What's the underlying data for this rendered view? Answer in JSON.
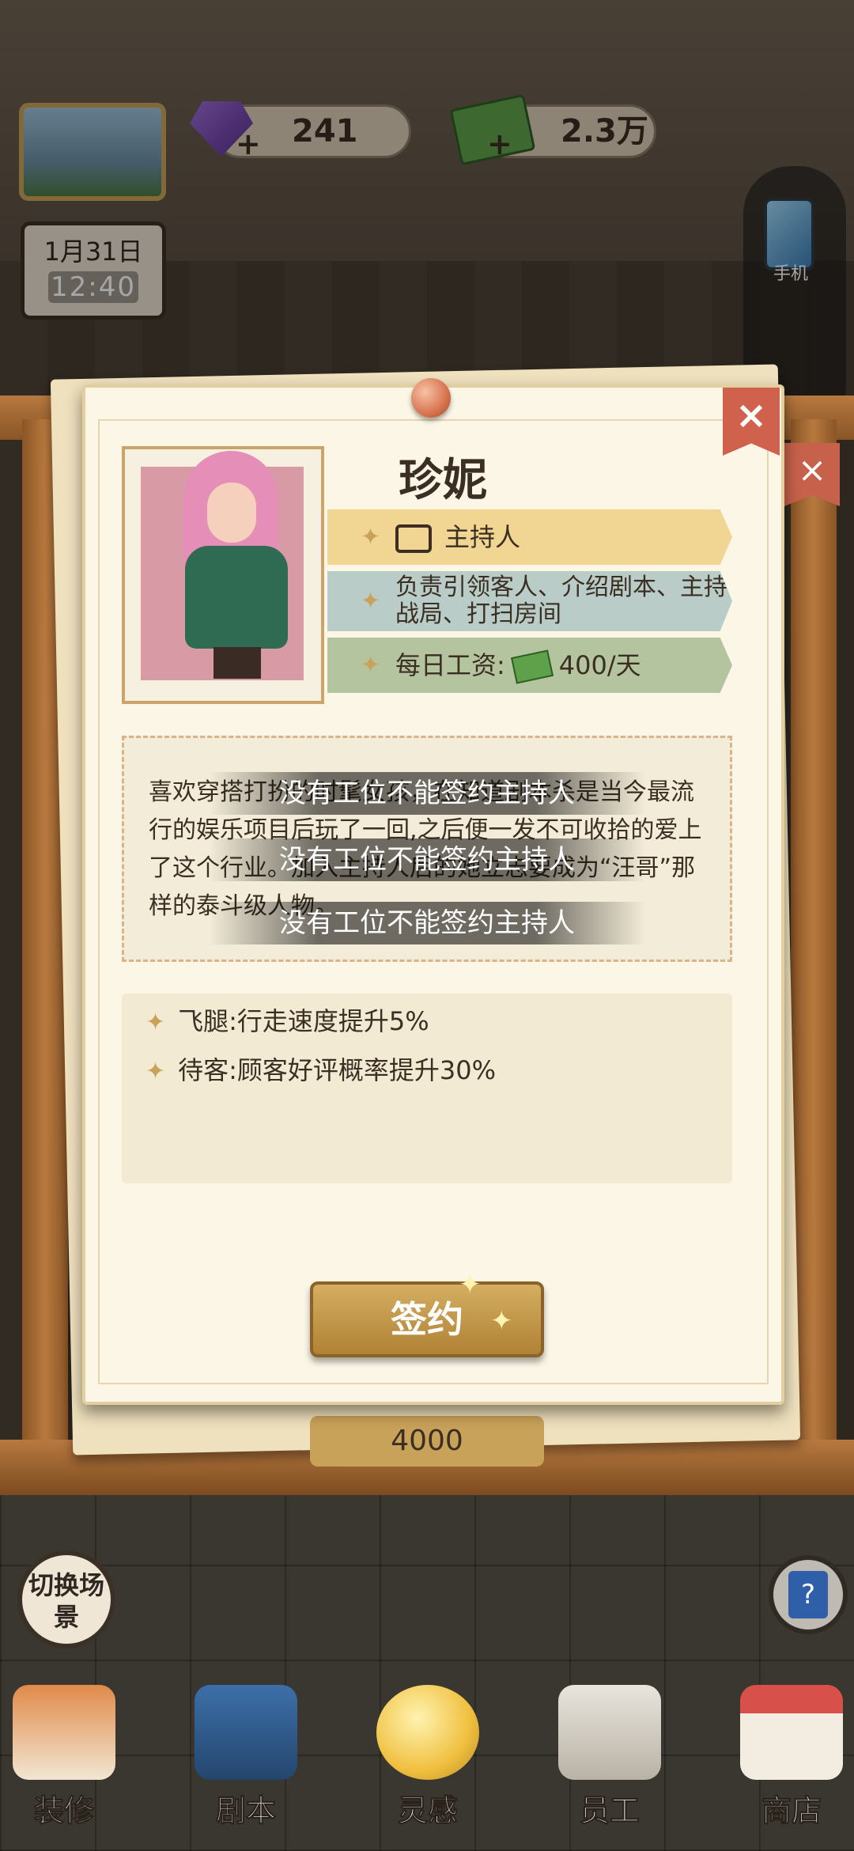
{
  "hud": {
    "gems": "241",
    "cash": "2.3万",
    "date": "1月31日",
    "time": "12:40",
    "phone_label": "手机"
  },
  "behind_cost": "4000",
  "close_label": "×",
  "profile": {
    "name": "珍妮",
    "role": "主持人",
    "duty": "负责引领客人、介绍剧本、主持战局、打扫房间",
    "wage_label": "每日工资:",
    "wage_value": "400/天",
    "bio": "喜欢穿搭打扮的时髦女孩，在知道剧本杀是当今最流行的娱乐项目后玩了一回,之后便一发不可收拾的爱上了这个行业。加入主持人后的她立志要成为“汪哥”那样的泰斗级人物。",
    "skills": [
      "飞腿:行走速度提升5%",
      "待客:顾客好评概率提升30%"
    ],
    "sign_label": "签约"
  },
  "toasts": [
    "没有工位不能签约主持人",
    "没有工位不能签约主持人",
    "没有工位不能签约主持人"
  ],
  "nav": {
    "switch_scene": "切换场景",
    "help": "?",
    "items": [
      "装修",
      "剧本",
      "灵感",
      "员工",
      "商店"
    ]
  }
}
